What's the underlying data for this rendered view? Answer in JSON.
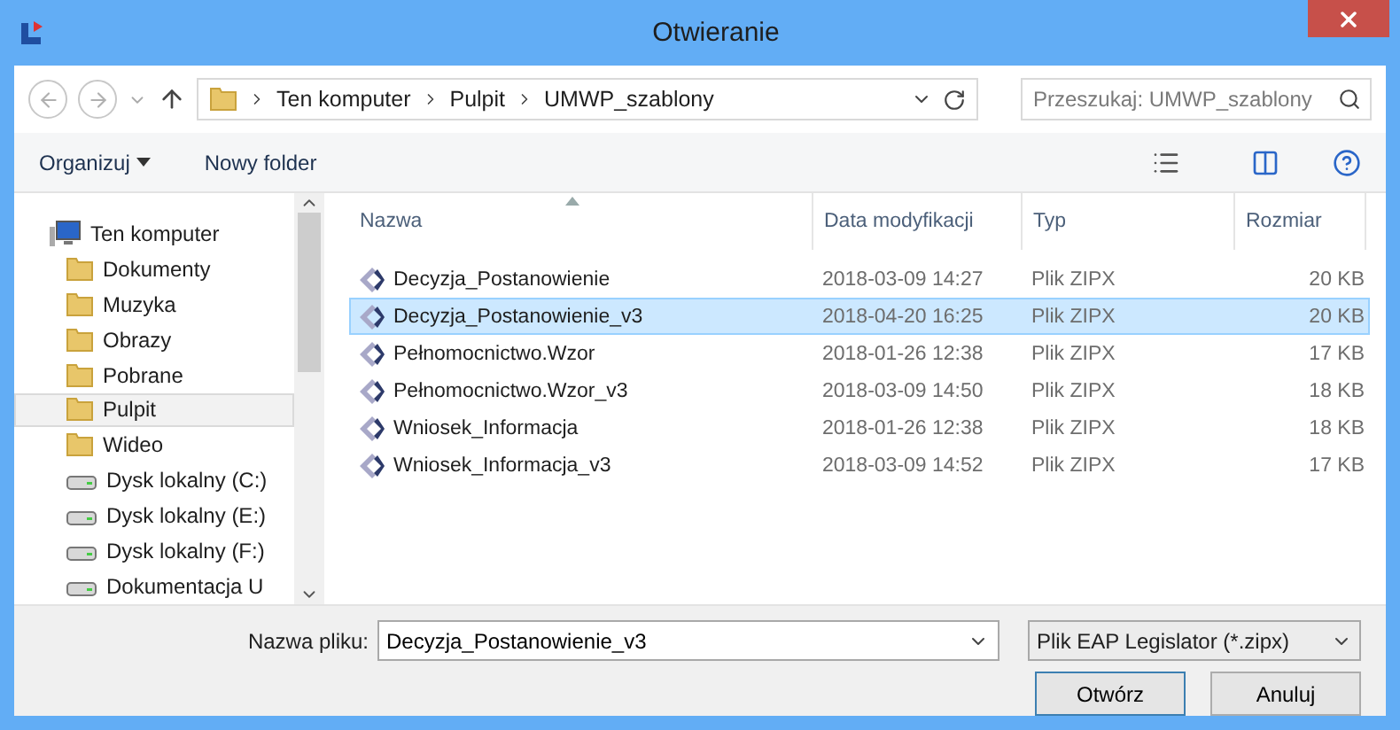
{
  "window": {
    "title": "Otwieranie"
  },
  "address": {
    "crumbs": [
      "Ten komputer",
      "Pulpit",
      "UMWP_szablony"
    ]
  },
  "search": {
    "placeholder": "Przeszukaj: UMWP_szablony"
  },
  "toolbar": {
    "organize": "Organizuj",
    "new_folder": "Nowy folder"
  },
  "nav": [
    {
      "label": "Ten komputer",
      "kind": "computer",
      "selected": false,
      "children": [
        {
          "label": "Dokumenty",
          "kind": "folder",
          "selected": false
        },
        {
          "label": "Muzyka",
          "kind": "folder",
          "selected": false
        },
        {
          "label": "Obrazy",
          "kind": "folder",
          "selected": false
        },
        {
          "label": "Pobrane",
          "kind": "folder",
          "selected": false
        },
        {
          "label": "Pulpit",
          "kind": "folder",
          "selected": true
        },
        {
          "label": "Wideo",
          "kind": "folder",
          "selected": false
        },
        {
          "label": "Dysk lokalny (C:)",
          "kind": "drive",
          "selected": false
        },
        {
          "label": "Dysk lokalny (E:)",
          "kind": "drive",
          "selected": false
        },
        {
          "label": "Dysk lokalny (F:)",
          "kind": "drive",
          "selected": false
        },
        {
          "label": "Dokumentacja U",
          "kind": "drive",
          "selected": false
        }
      ]
    }
  ],
  "table": {
    "columns": [
      "Nazwa",
      "Data modyfikacji",
      "Typ",
      "Rozmiar"
    ],
    "rows": [
      {
        "name": "Decyzja_Postanowienie",
        "date": "2018-03-09 14:27",
        "type": "Plik ZIPX",
        "size": "20 KB",
        "selected": false
      },
      {
        "name": "Decyzja_Postanowienie_v3",
        "date": "2018-04-20 16:25",
        "type": "Plik ZIPX",
        "size": "20 KB",
        "selected": true
      },
      {
        "name": "Pełnomocnictwo.Wzor",
        "date": "2018-01-26 12:38",
        "type": "Plik ZIPX",
        "size": "17 KB",
        "selected": false
      },
      {
        "name": "Pełnomocnictwo.Wzor_v3",
        "date": "2018-03-09 14:50",
        "type": "Plik ZIPX",
        "size": "18 KB",
        "selected": false
      },
      {
        "name": "Wniosek_Informacja",
        "date": "2018-01-26 12:38",
        "type": "Plik ZIPX",
        "size": "18 KB",
        "selected": false
      },
      {
        "name": "Wniosek_Informacja_v3",
        "date": "2018-03-09 14:52",
        "type": "Plik ZIPX",
        "size": "17 KB",
        "selected": false
      }
    ]
  },
  "footer": {
    "file_name_label": "Nazwa pliku:",
    "file_name": "Decyzja_Postanowienie_v3",
    "filter": "Plik EAP Legislator (*.zipx)",
    "buttons": [
      "Otwórz",
      "Anuluj"
    ]
  }
}
